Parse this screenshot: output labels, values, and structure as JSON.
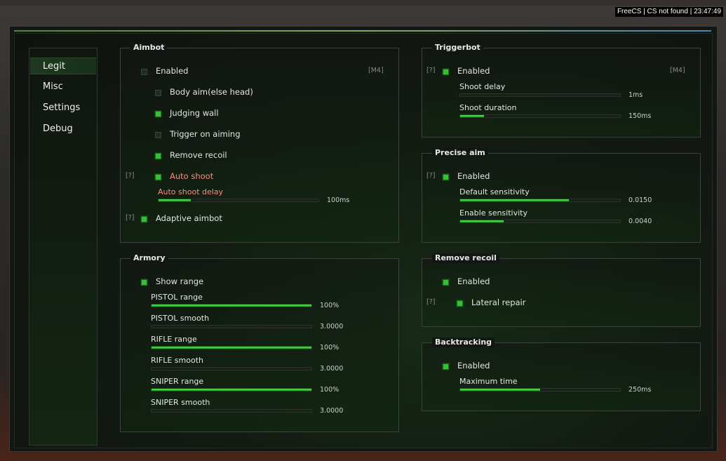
{
  "watermark": "FreeCS | CS not found | 23:47:49",
  "sidebar": {
    "items": [
      {
        "label": "Legit",
        "active": true
      },
      {
        "label": "Misc"
      },
      {
        "label": "Settings"
      },
      {
        "label": "Debug"
      }
    ]
  },
  "aimbot": {
    "title": "Aimbot",
    "enabled": {
      "label": "Enabled",
      "on": false,
      "key": "[M4]"
    },
    "body_aim": {
      "label": "Body aim(else head)",
      "on": false
    },
    "judging_wall": {
      "label": "Judging wall",
      "on": true
    },
    "trigger_on_aiming": {
      "label": "Trigger on aiming",
      "on": false
    },
    "remove_recoil": {
      "label": "Remove recoil",
      "on": true
    },
    "auto_shoot": {
      "label": "Auto shoot",
      "on": true,
      "hint": "[?]"
    },
    "auto_shoot_delay": {
      "label": "Auto shoot delay",
      "value": "100ms",
      "fraction": 0.2
    },
    "adaptive_aimbot": {
      "label": "Adaptive aimbot",
      "on": true,
      "hint": "[?]"
    }
  },
  "armory": {
    "title": "Armory",
    "show_range": {
      "label": "Show range",
      "on": true
    },
    "sliders": [
      {
        "label": "PISTOL range",
        "value": "100%",
        "fraction": 1.0
      },
      {
        "label": "PISTOL smooth",
        "value": "3.0000",
        "fraction": 0.0
      },
      {
        "label": "RIFLE range",
        "value": "100%",
        "fraction": 1.0
      },
      {
        "label": "RIFLE smooth",
        "value": "3.0000",
        "fraction": 0.0
      },
      {
        "label": "SNIPER range",
        "value": "100%",
        "fraction": 1.0
      },
      {
        "label": "SNIPER smooth",
        "value": "3.0000",
        "fraction": 0.0
      }
    ]
  },
  "triggerbot": {
    "title": "Triggerbot",
    "enabled": {
      "label": "Enabled",
      "on": true,
      "hint": "[?]",
      "key": "[M4]"
    },
    "shoot_delay": {
      "label": "Shoot delay",
      "value": "1ms",
      "fraction": 0.0
    },
    "shoot_duration": {
      "label": "Shoot duration",
      "value": "150ms",
      "fraction": 0.15
    }
  },
  "precise_aim": {
    "title": "Precise aim",
    "enabled": {
      "label": "Enabled",
      "on": true,
      "hint": "[?]"
    },
    "default_sensitivity": {
      "label": "Default sensitivity",
      "value": "0.0150",
      "fraction": 0.68
    },
    "enable_sensitivity": {
      "label": "Enable sensitivity",
      "value": "0.0040",
      "fraction": 0.27
    }
  },
  "remove_recoil": {
    "title": "Remove recoil",
    "enabled": {
      "label": "Enabled",
      "on": true
    },
    "lateral_repair": {
      "label": "Lateral repair",
      "on": true,
      "hint": "[?]"
    }
  },
  "backtracking": {
    "title": "Backtracking",
    "enabled": {
      "label": "Enabled",
      "on": true
    },
    "maximum_time": {
      "label": "Maximum time",
      "value": "250ms",
      "fraction": 0.5
    }
  }
}
